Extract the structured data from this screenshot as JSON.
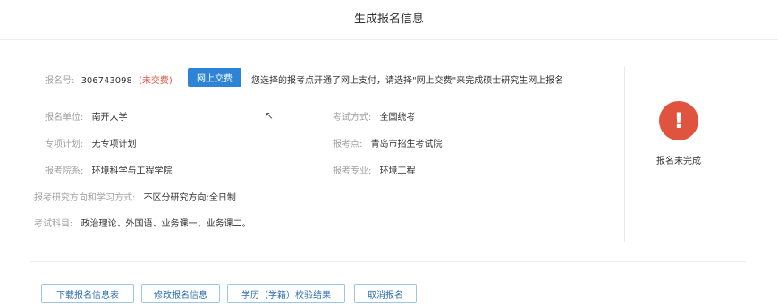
{
  "page": {
    "title": "生成报名信息"
  },
  "info": {
    "reg_no_label": "报名号:",
    "reg_no_value": "306743098",
    "reg_status": "(未交费)",
    "pay_button": "网上交费",
    "notice": "您选择的报考点开通了网上支付，请选择\"网上交费\"来完成硕士研究生网上报名",
    "unit_label": "报名单位:",
    "unit_value": "南开大学",
    "exam_mode_label": "考试方式:",
    "exam_mode_value": "全国统考",
    "plan_label": "专项计划:",
    "plan_value": "无专项计划",
    "site_label": "报考点:",
    "site_value": "青岛市招生考试院",
    "dept_label": "报考院系:",
    "dept_value": "环境科学与工程学院",
    "major_label": "报考专业:",
    "major_value": "环境工程",
    "direction_label": "报考研究方向和学习方式:",
    "direction_value": "不区分研究方向;全日制",
    "subjects_label": "考试科目:",
    "subjects_value": "政治理论、外国语、业务课一、业务课二。"
  },
  "status": {
    "icon": "exclamation-icon",
    "color": "#e0533e",
    "text": "报名未完成"
  },
  "actions": {
    "download": "下载报名信息表",
    "modify": "修改报名信息",
    "verify": "学历（学籍）校验结果",
    "cancel": "取消报名"
  }
}
